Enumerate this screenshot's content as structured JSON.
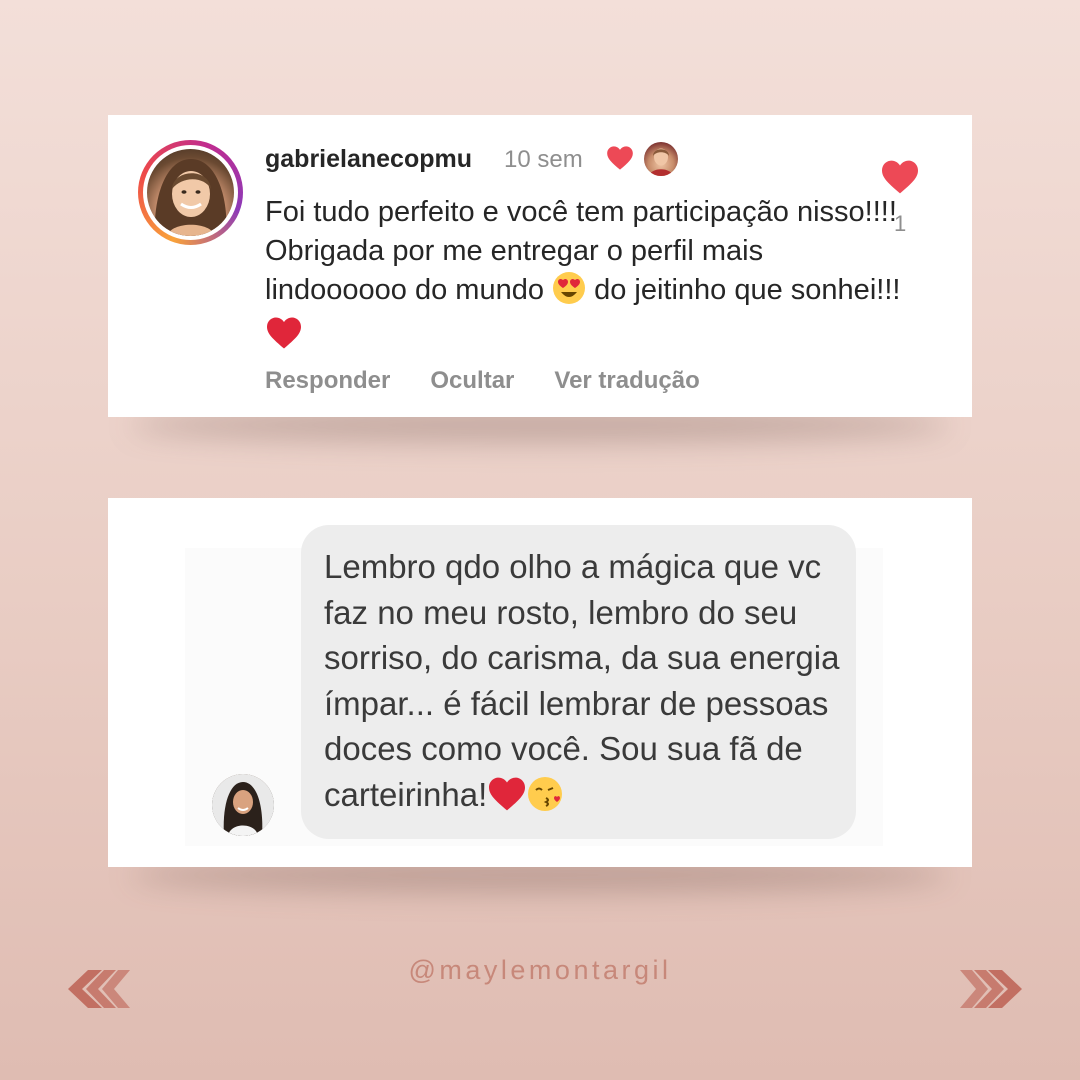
{
  "comment_card": {
    "username": "gabrielanecopmu",
    "time": "10 sem",
    "comment_text": "Foi tudo perfeito e você tem participação nisso!!!! Obrigada por me entregar o perfil mais lindoooooo do mundo",
    "comment_tail": " do jeitinho que sonhei!!! ",
    "actions": [
      "Responder",
      "Ocultar",
      "Ver tradução"
    ],
    "like_count": "1"
  },
  "dm_card": {
    "message_text": "Lembro qdo olho a mágica que vc faz no meu rosto, lembro do seu sorriso, do carisma, da sua energia ímpar... é fácil lembrar de pessoas doces como você. Sou sua fã de carteirinha!"
  },
  "footer": {
    "handle": "@maylemontargil"
  },
  "colors": {
    "like_red": "#ed4956",
    "handle_color": "#c7887a",
    "arrow_color": "#c26f62"
  },
  "icons": {
    "liked_by_author": "heart-icon",
    "like_button": "heart-icon",
    "emojis": [
      "heart-eyes-emoji",
      "red-heart-emoji",
      "kissing-face-emoji"
    ],
    "navigation": [
      "chevrons-left-icon",
      "chevrons-right-icon"
    ]
  }
}
